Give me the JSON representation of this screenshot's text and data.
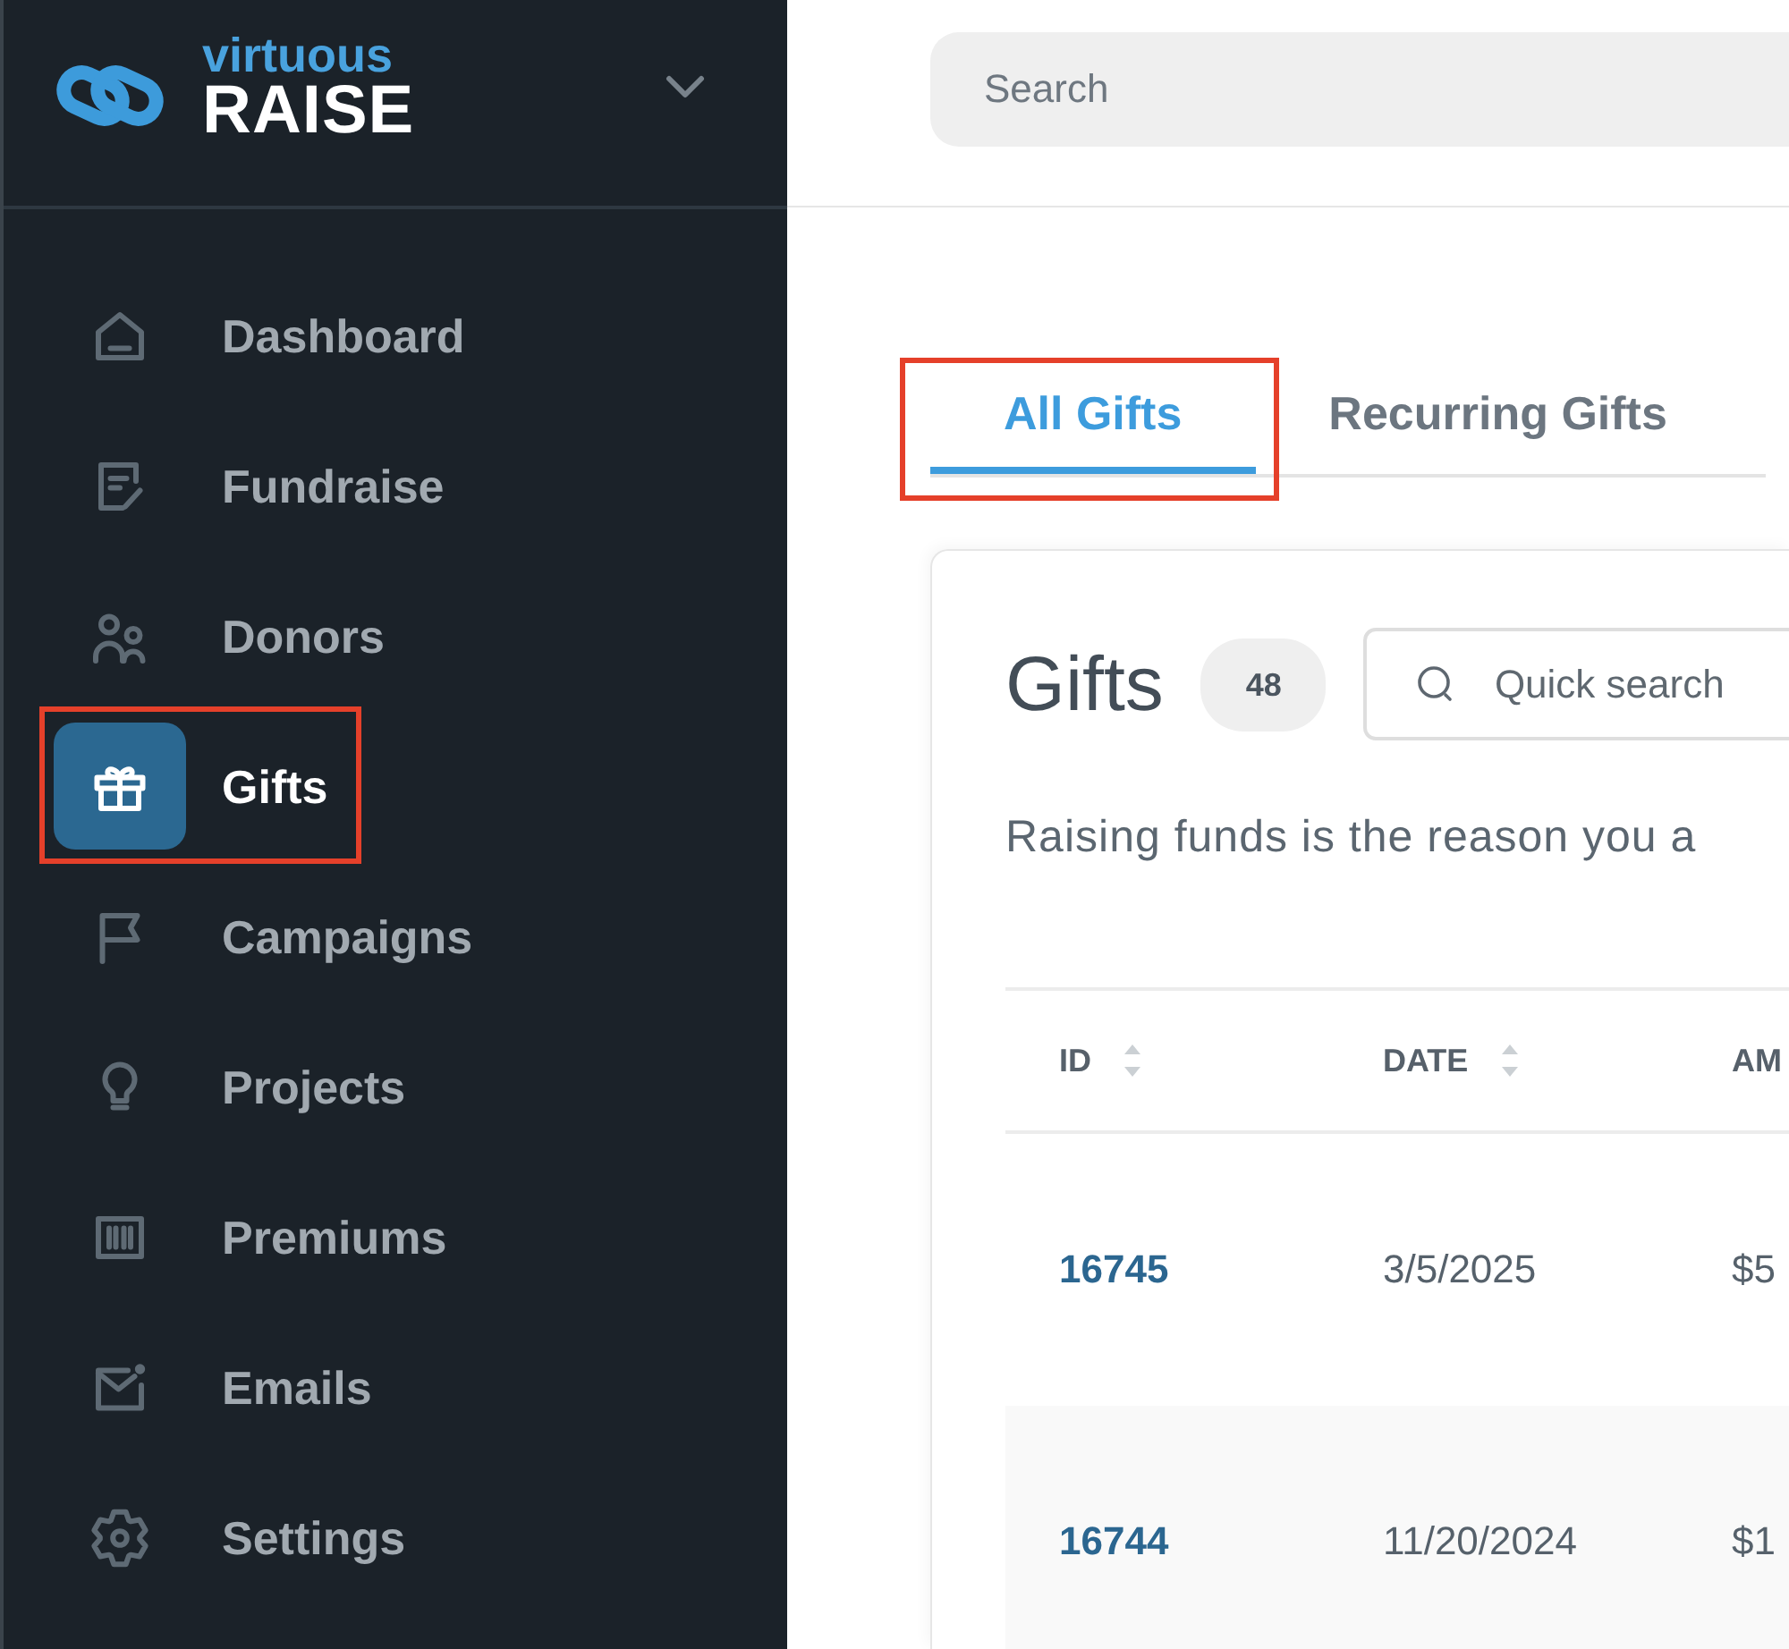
{
  "sidebar": {
    "brand": {
      "tagline": "virtuous",
      "name": "RAISE"
    },
    "items": [
      {
        "label": "Dashboard",
        "selected": false,
        "highlighted": false
      },
      {
        "label": "Fundraise",
        "selected": false,
        "highlighted": false
      },
      {
        "label": "Donors",
        "selected": false,
        "highlighted": false
      },
      {
        "label": "Gifts",
        "selected": true,
        "highlighted": true
      },
      {
        "label": "Campaigns",
        "selected": false,
        "highlighted": false
      },
      {
        "label": "Projects",
        "selected": false,
        "highlighted": false
      },
      {
        "label": "Premiums",
        "selected": false,
        "highlighted": false
      },
      {
        "label": "Emails",
        "selected": false,
        "highlighted": false
      },
      {
        "label": "Settings",
        "selected": false,
        "highlighted": false
      }
    ]
  },
  "search": {
    "placeholder": "Search"
  },
  "tabs": [
    {
      "label": "All Gifts",
      "selected": true,
      "highlighted": true
    },
    {
      "label": "Recurring Gifts",
      "selected": false,
      "highlighted": false
    }
  ],
  "gifts": {
    "title": "Gifts",
    "count": "48",
    "quick_search": {
      "placeholder": "Quick search"
    },
    "description": "Raising funds is the reason you a",
    "table": {
      "columns": [
        {
          "label": "ID",
          "sortable": true
        },
        {
          "label": "DATE",
          "sortable": true
        },
        {
          "label": "AM",
          "sortable": false
        }
      ],
      "rows": [
        {
          "cells": [
            "16745",
            "3/5/2025",
            "$5"
          ]
        },
        {
          "cells": [
            "16744",
            "11/20/2024",
            "$1"
          ]
        }
      ]
    }
  }
}
